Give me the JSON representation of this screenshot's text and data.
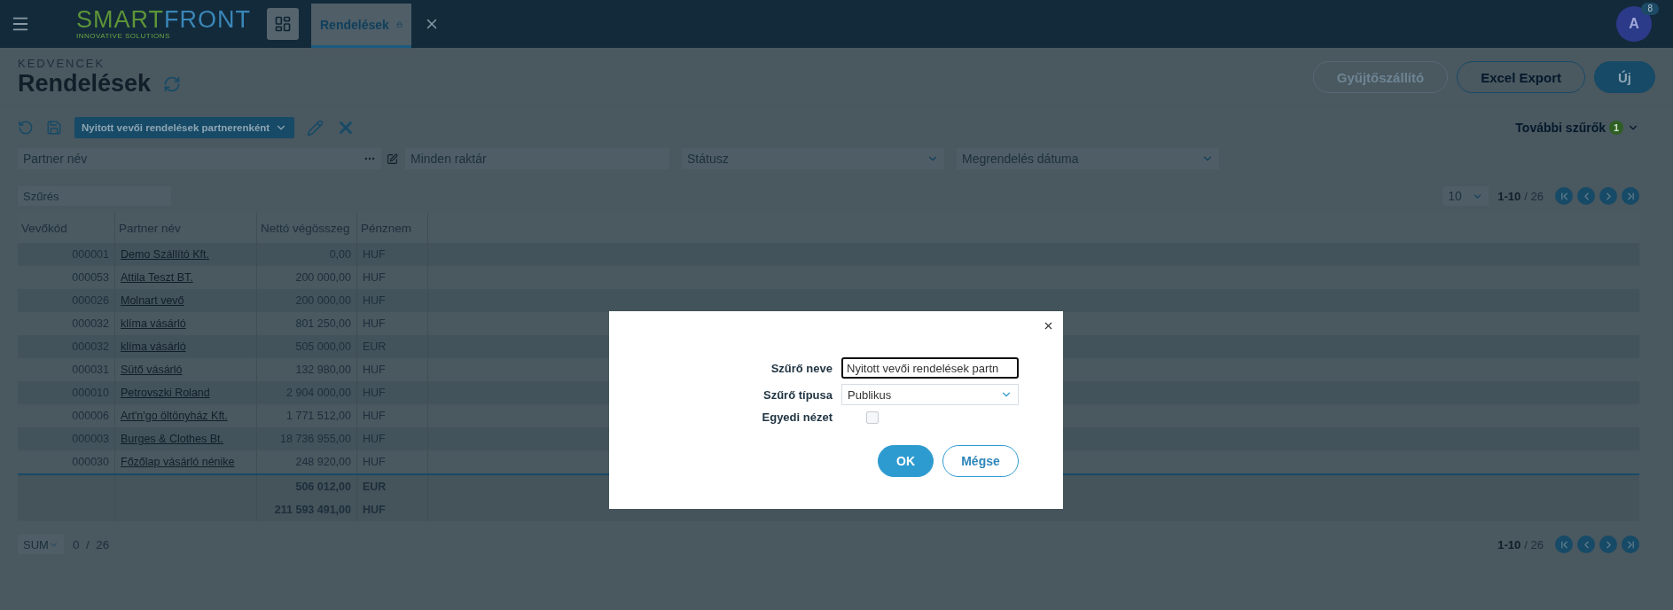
{
  "topbar": {
    "logo": {
      "first": "SMART",
      "second": "FRONT",
      "tagline": "INNOVATIVE SOLUTIONS"
    },
    "tabs": [
      {
        "label": "Rendelések",
        "selected": true,
        "locked": true
      }
    ],
    "user": {
      "initial": "A",
      "badge": "8"
    }
  },
  "header": {
    "breadcrumb": "KEDVENCEK",
    "title": "Rendelések",
    "buttons": [
      {
        "label": "Gyűjtőszállító",
        "kind": "outline",
        "disabled": true
      },
      {
        "label": "Excel Export",
        "kind": "outline",
        "disabled": false
      },
      {
        "label": "Új",
        "kind": "primary",
        "disabled": false
      }
    ]
  },
  "filterbar": {
    "saved_filter": "Nyitott vevői rendelések partnerenként",
    "more_filters": {
      "label": "További szűrők",
      "count": "1"
    }
  },
  "filters": [
    {
      "placeholder": "Partner név",
      "kind": "lookup"
    },
    {
      "placeholder": "Minden raktár",
      "kind": "text"
    },
    {
      "placeholder": "Státusz",
      "kind": "select"
    },
    {
      "placeholder": "Megrendelés dátuma",
      "kind": "select"
    }
  ],
  "search": {
    "placeholder": "Szűrés"
  },
  "pager": {
    "page_size": "10",
    "range": "1-10",
    "of": "/ 26"
  },
  "table": {
    "columns": [
      "Vevőkód",
      "Partner név",
      "Nettó végösszeg",
      "Pénznem"
    ],
    "rows": [
      {
        "code": "000001",
        "partner": "Demo Szállító Kft.",
        "net": "0,00",
        "currency": "HUF"
      },
      {
        "code": "000053",
        "partner": "Attila Teszt BT.",
        "net": "200 000,00",
        "currency": "HUF"
      },
      {
        "code": "000026",
        "partner": "Molnart vevő",
        "net": "200 000,00",
        "currency": "HUF"
      },
      {
        "code": "000032",
        "partner": "klíma vásárló",
        "net": "801 250,00",
        "currency": "HUF"
      },
      {
        "code": "000032",
        "partner": "klíma vásárló",
        "net": "505 000,00",
        "currency": "EUR"
      },
      {
        "code": "000031",
        "partner": "Sütő vásárló",
        "net": "132 980,00",
        "currency": "HUF"
      },
      {
        "code": "000010",
        "partner": "Petrovszki Roland",
        "net": "2 904 000,00",
        "currency": "HUF"
      },
      {
        "code": "000006",
        "partner": "Art'n'go öltönyház Kft.",
        "net": "1 771 512,00",
        "currency": "HUF"
      },
      {
        "code": "000003",
        "partner": "Burges & Clothes Bt.",
        "net": "18 736 955,00",
        "currency": "HUF"
      },
      {
        "code": "000030",
        "partner": "Főzőlap vásárló nénike",
        "net": "248 920,00",
        "currency": "HUF"
      }
    ],
    "totals": [
      {
        "amount": "506 012,00",
        "currency": "EUR"
      },
      {
        "amount": "211 593 491,00",
        "currency": "HUF"
      }
    ]
  },
  "footer": {
    "aggregate": "SUM",
    "selection": "0  /  26",
    "range": "1-10",
    "of": "/ 26"
  },
  "dialog": {
    "fields": [
      {
        "label": "Szűrő neve",
        "kind": "text",
        "value": "Nyitott vevői rendelések partn"
      },
      {
        "label": "Szűrő típusa",
        "kind": "select",
        "value": "Publikus"
      },
      {
        "label": "Egyedi nézet",
        "kind": "checkbox",
        "checked": false
      }
    ],
    "buttons": [
      {
        "label": "OK",
        "kind": "primary"
      },
      {
        "label": "Mégse",
        "kind": "outline"
      }
    ]
  }
}
